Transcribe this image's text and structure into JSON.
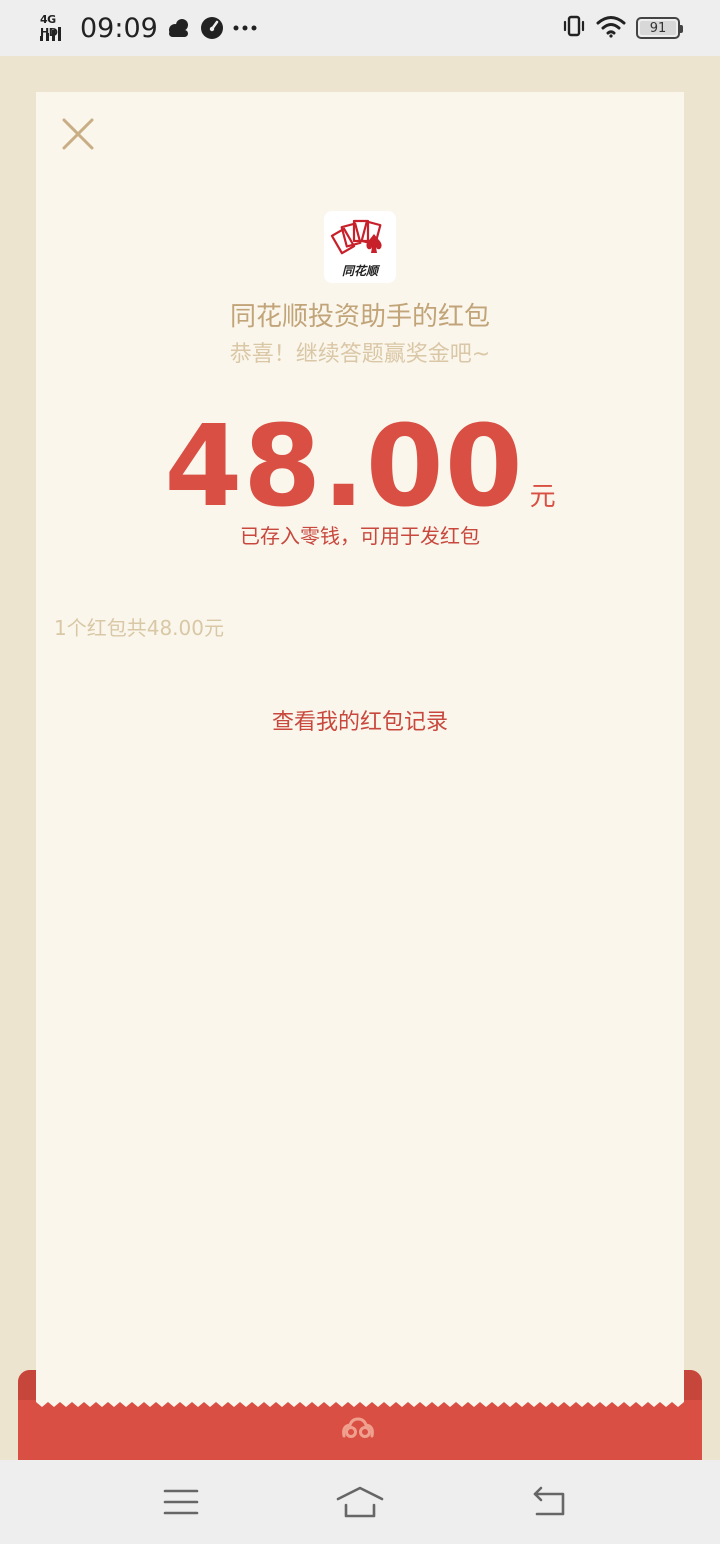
{
  "status_bar": {
    "network": "4G HD",
    "time": "09:09",
    "battery": "91",
    "battery_level": 0.91,
    "icons": [
      "signal-icon",
      "cloud-weather-icon",
      "speed-gauge-icon",
      "more-dots-icon",
      "vibrate-icon",
      "wifi-icon",
      "battery-icon"
    ]
  },
  "packet": {
    "close_icon": "close-icon",
    "logo_text": "同花顺",
    "sender": "同花顺投资助手的红包",
    "wish": "恭喜！继续答题赢奖金吧~",
    "amount": "48.00",
    "unit": "元",
    "stored_note": "已存入零钱，可用于发红包",
    "summary": "1个红包共48.00元",
    "record_link": "查看我的红包记录"
  },
  "nav_bar": {
    "icons": [
      "menu-icon",
      "home-icon",
      "back-icon"
    ]
  },
  "colors": {
    "accent_red": "#d94f43",
    "gold_text": "#c2a479",
    "card_bg": "#faf6ec",
    "page_bg": "#ede4d0"
  }
}
